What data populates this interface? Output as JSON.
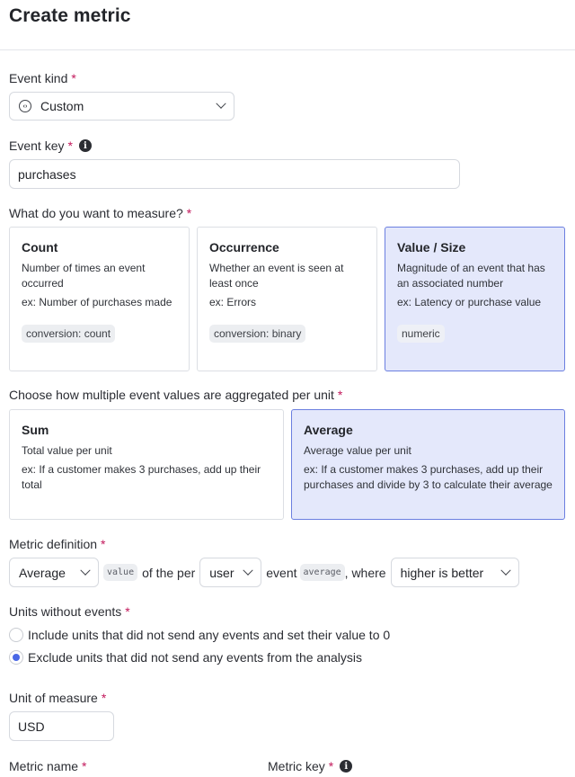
{
  "header": {
    "title": "Create metric"
  },
  "event_kind": {
    "label": "Event kind",
    "required": "*",
    "value": "Custom"
  },
  "event_key": {
    "label": "Event key",
    "required": "*",
    "info": "i",
    "value": "purchases"
  },
  "measure": {
    "label": "What do you want to measure?",
    "required": "*",
    "options": [
      {
        "title": "Count",
        "desc": "Number of times an event occurred",
        "example": "ex: Number of purchases made",
        "tag": "conversion: count",
        "selected": false
      },
      {
        "title": "Occurrence",
        "desc": "Whether an event is seen at least once",
        "example": "ex: Errors",
        "tag": "conversion: binary",
        "selected": false
      },
      {
        "title": "Value / Size",
        "desc": "Magnitude of an event that has an associated number",
        "example": "ex: Latency or purchase value",
        "tag": "numeric",
        "selected": true
      }
    ]
  },
  "aggregation": {
    "label": "Choose how multiple event values are aggregated per unit",
    "required": "*",
    "options": [
      {
        "title": "Sum",
        "desc": "Total value per unit",
        "example": "ex: If a customer makes 3 purchases, add up their total",
        "selected": false
      },
      {
        "title": "Average",
        "desc": "Average value per unit",
        "example": "ex: If a customer makes 3 purchases, add up their purchases and divide by 3 to calculate their average",
        "selected": true
      }
    ]
  },
  "definition": {
    "label": "Metric definition",
    "required": "*",
    "aggregate_select": "Average",
    "code_value": "value",
    "text_of_the_per": "of the per",
    "unit_select": "user",
    "text_event": "event",
    "code_average": "average",
    "text_where": ", where",
    "direction_select": "higher is better"
  },
  "units_without_events": {
    "label": "Units without events",
    "required": "*",
    "options": [
      {
        "label": "Include units that did not send any events and set their value to 0",
        "checked": false
      },
      {
        "label": "Exclude units that did not send any events from the analysis",
        "checked": true
      }
    ]
  },
  "unit_of_measure": {
    "label": "Unit of measure",
    "required": "*",
    "value": "USD"
  },
  "metric_name": {
    "label": "Metric name",
    "required": "*"
  },
  "metric_key": {
    "label": "Metric key",
    "required": "*",
    "info": "i"
  }
}
